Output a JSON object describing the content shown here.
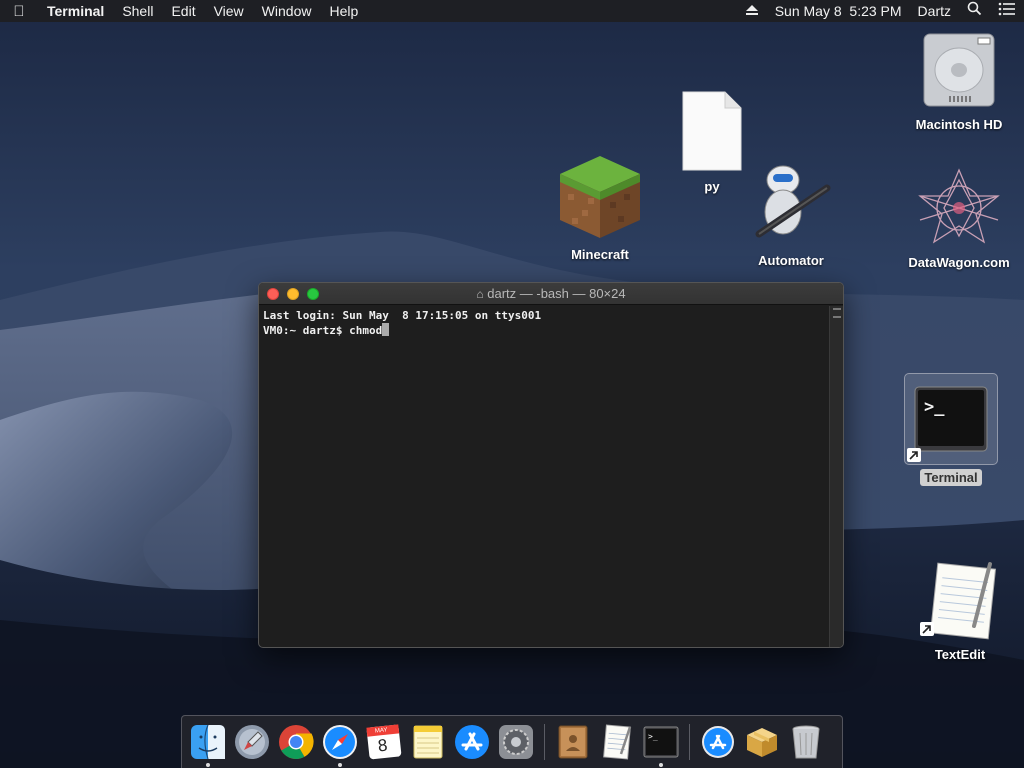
{
  "menubar": {
    "apple_icon": "apple-icon",
    "app_name": "Terminal",
    "menus": [
      "Shell",
      "Edit",
      "View",
      "Window",
      "Help"
    ],
    "clock": "Sun May 8  5:23 PM",
    "user": "Dartz"
  },
  "desktop": {
    "icons": {
      "macintosh_hd": "Macintosh HD",
      "py": "py",
      "minecraft": "Minecraft",
      "automator": "Automator",
      "datawagon": "DataWagon.com",
      "terminal": "Terminal",
      "textedit": "TextEdit"
    }
  },
  "terminal": {
    "title": "dartz — -bash — 80×24",
    "line1": "Last login: Sun May  8 17:15:05 on ttys001",
    "prompt": "VM0:~ dartz$ ",
    "input": "chmod"
  },
  "dock": {
    "calendar_month": "MAY",
    "calendar_day": "8",
    "items": [
      "Finder",
      "Launchpad",
      "Google Chrome",
      "Safari",
      "Calendar",
      "Notes",
      "App Store",
      "System Preferences",
      "Contacts",
      "TextEdit",
      "Terminal",
      "Downloads",
      "Packages",
      "Trash"
    ]
  },
  "colors": {
    "accent_blue": "#1a8cff",
    "close": "#fe5f57",
    "minimize": "#febc2e",
    "maximize": "#28c840"
  }
}
